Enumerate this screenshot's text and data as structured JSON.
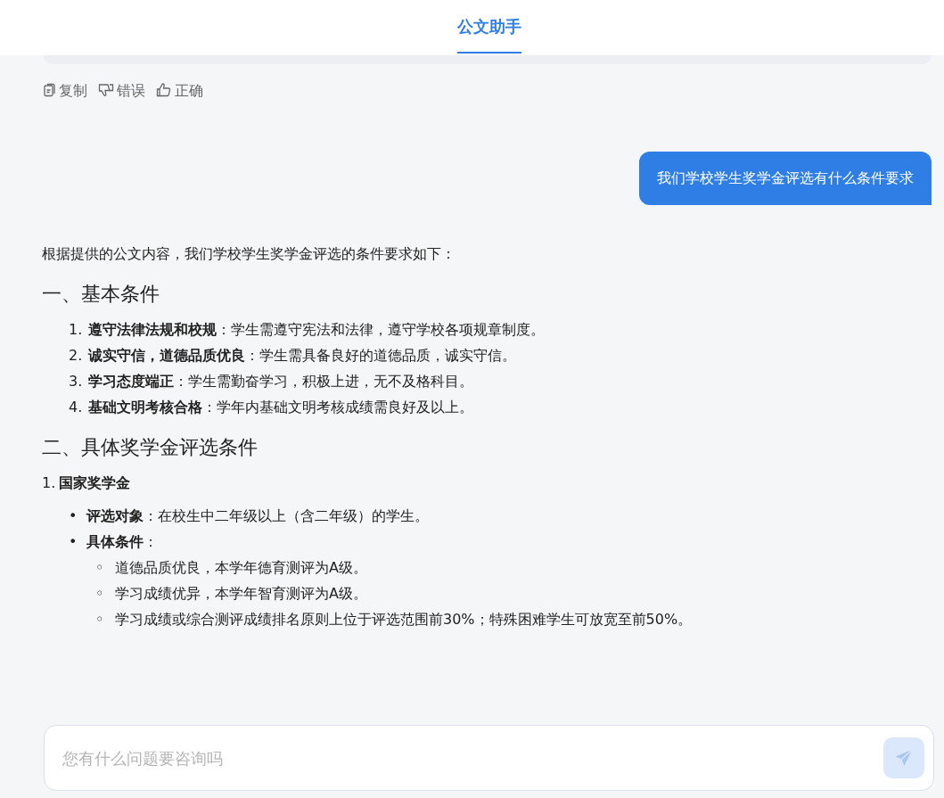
{
  "header": {
    "tab": {
      "label": "公文助手",
      "selected": true
    }
  },
  "actions": [
    {
      "kind": "copy",
      "label": "复制"
    },
    {
      "kind": "dislike",
      "label": "错误"
    },
    {
      "kind": "like",
      "label": "正确"
    }
  ],
  "question": {
    "text": "我们学校学生奖学金评选有什么条件要求"
  },
  "answer": [
    {
      "kind": "paragraph",
      "text": "根据提供的公文内容，我们学校学生奖学金评选的条件要求如下："
    },
    {
      "kind": "heading",
      "text": "一、基本条件"
    },
    {
      "kind": "list",
      "items": [
        {
          "marker": "1.",
          "text": "**遵守法律法规和校规**：学生需遵守宪法和法律，遵守学校各项规章制度。"
        },
        {
          "marker": "2.",
          "text": "**诚实守信，道德品质优良**：学生需具备良好的道德品质，诚实守信。"
        },
        {
          "marker": "3.",
          "text": "**学习态度端正**：学生需勤奋学习，积极上进，无不及格科目。"
        },
        {
          "marker": "4.",
          "text": "**基础文明考核合格**：学年内基础文明考核成绩需良好及以上。"
        }
      ]
    },
    {
      "kind": "heading",
      "text": "二、具体奖学金评选条件"
    },
    {
      "kind": "subheading",
      "marker": "1.",
      "text": "国家奖学金"
    },
    {
      "kind": "list",
      "items": [
        {
          "marker": "•",
          "text": "**评选对象**：在校生中二年级以上（含二年级）的学生。"
        },
        {
          "marker": "•",
          "text": "**具体条件**：",
          "children": [
            {
              "marker": "◦",
              "text": "道德品质优良，本学年德育测评为A级。"
            },
            {
              "marker": "◦",
              "text": "学习成绩优异，本学年智育测评为A级。"
            },
            {
              "marker": "◦",
              "text": "学习成绩或综合测评成绩排名原则上位于评选范围前30%；特殊困难学生可放宽至前50%。"
            }
          ]
        }
      ]
    }
  ],
  "input": {
    "placeholder": "您有什么问题要咨询吗"
  }
}
